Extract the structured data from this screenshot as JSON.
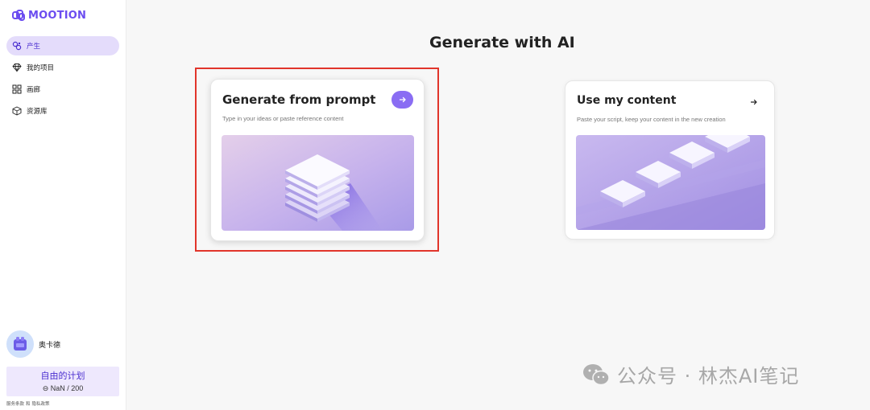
{
  "brand": {
    "name": "MOOTION",
    "color": "#6b4cf0"
  },
  "sidebar": {
    "items": [
      {
        "label": "产生",
        "icon": "sparkle-icon",
        "active": true
      },
      {
        "label": "我的项目",
        "icon": "diamond-icon",
        "active": false
      },
      {
        "label": "画廊",
        "icon": "grid-icon",
        "active": false
      },
      {
        "label": "资源库",
        "icon": "box-icon",
        "active": false
      }
    ],
    "user": {
      "name": "奥卡德",
      "avatar_icon": "avatar-icon"
    },
    "plan": {
      "title": "自由的计划",
      "credits": "⊖ NaN / 200"
    },
    "legal": [
      "服务条款",
      "和",
      "隐私政策"
    ]
  },
  "main": {
    "title": "Generate with AI",
    "cards": [
      {
        "title": "Generate from prompt",
        "desc": "Type in your ideas or paste reference content",
        "icon": "arrow-right-icon"
      },
      {
        "title": "Use my content",
        "desc": "Paste your script, keep your content in the new creation",
        "icon": "arrow-right-icon"
      }
    ]
  },
  "watermark": {
    "text": "公众号 · 林杰AI笔记",
    "icon": "wechat-icon"
  },
  "colors": {
    "accent": "#8a6df3",
    "active_bg": "#e4dcfb",
    "highlight": "#e1352b"
  }
}
